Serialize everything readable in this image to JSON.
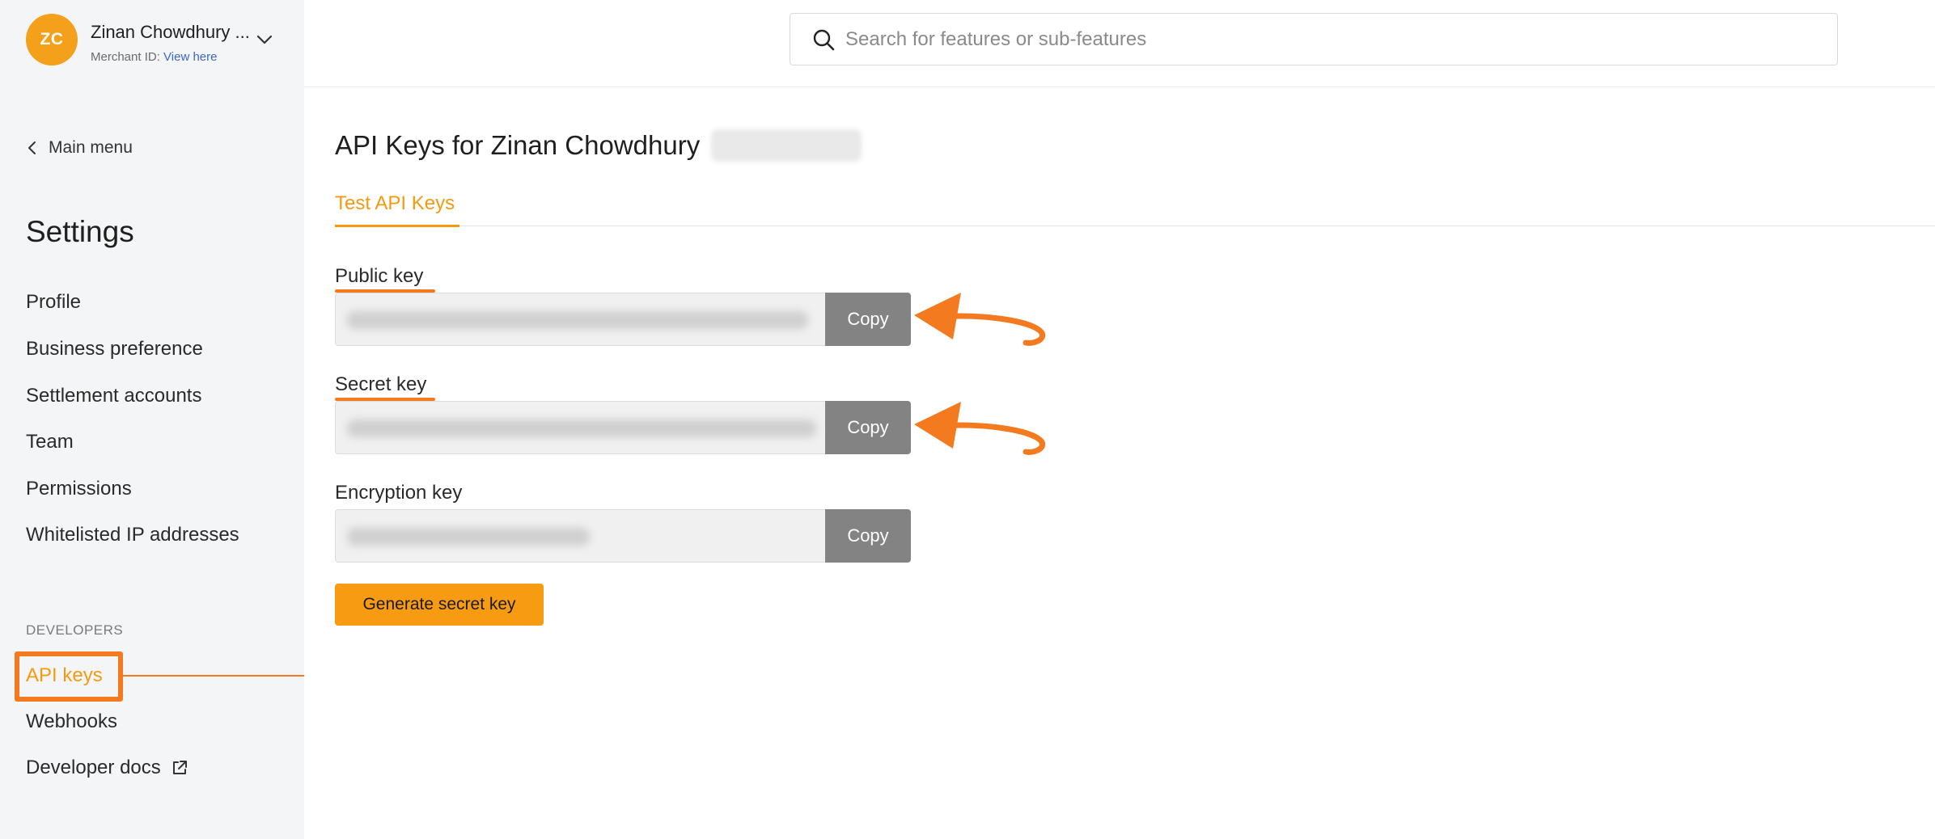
{
  "account": {
    "initials": "ZC",
    "name": "Zinan Chowdhury ...",
    "merchant_label": "Merchant ID:",
    "merchant_link": "View here"
  },
  "sidebar": {
    "back_label": "Main menu",
    "title": "Settings",
    "items": [
      {
        "label": "Profile"
      },
      {
        "label": "Business preference"
      },
      {
        "label": "Settlement accounts"
      },
      {
        "label": "Team"
      },
      {
        "label": "Permissions"
      },
      {
        "label": "Whitelisted IP addresses"
      }
    ],
    "developers_section": "DEVELOPERS",
    "developer_items": [
      {
        "label": "API keys"
      },
      {
        "label": "Webhooks"
      },
      {
        "label": "Developer docs"
      }
    ]
  },
  "search": {
    "placeholder": "Search for features or sub-features"
  },
  "main": {
    "title": "API Keys for Zinan Chowdhury",
    "tab_label": "Test API Keys",
    "keys": [
      {
        "label": "Public key",
        "copy_label": "Copy"
      },
      {
        "label": "Secret key",
        "copy_label": "Copy"
      },
      {
        "label": "Encryption key",
        "copy_label": "Copy"
      }
    ],
    "generate_label": "Generate secret key"
  },
  "colors": {
    "accent": "#f49a12",
    "annotation": "#f47a20",
    "avatar": "#f5a01a",
    "copy_button": "#838383",
    "sidebar_bg": "#f4f5f6"
  },
  "icons": [
    "chevron-down-icon",
    "chevron-left-icon",
    "search-icon",
    "external-link-icon",
    "arrow-annotation-icon"
  ]
}
